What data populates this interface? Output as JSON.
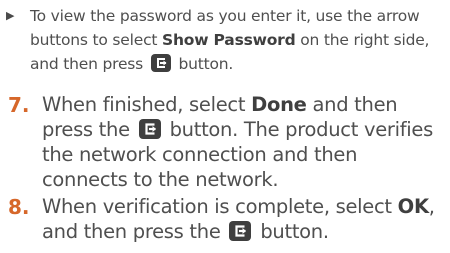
{
  "bullet": {
    "marker": "▶",
    "text_1": "To view the password as you enter it, use the arrow buttons to select ",
    "emph_1": "Show Password",
    "text_2": " on the right side, and then press ",
    "text_3": " button.",
    "icon": "enter-icon"
  },
  "steps": [
    {
      "number": "7.",
      "text_1": "When finished, select ",
      "emph_1": "Done",
      "text_2": " and then press the ",
      "text_3": " button. The product verifies the network connection and then connects to the network.",
      "icon": "enter-icon"
    },
    {
      "number": "8.",
      "text_1": "When verification is complete, select ",
      "emph_1": "OK",
      "text_2": ", and then press the ",
      "text_3": " button.",
      "icon": "enter-icon"
    }
  ],
  "colors": {
    "step_number": "#d6672a",
    "body_text": "#4f4f4f",
    "icon_bg": "#3f3f3f"
  }
}
